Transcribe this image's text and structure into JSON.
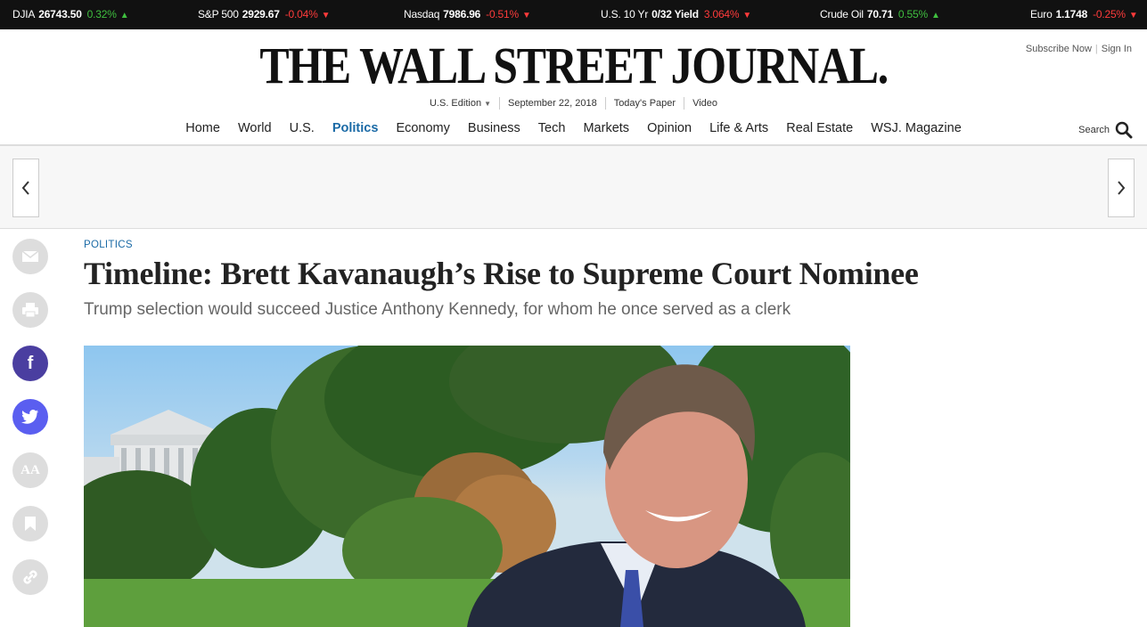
{
  "ticker": [
    {
      "name": "DJIA",
      "value": "26743.50",
      "change": "0.32%",
      "dir": "up"
    },
    {
      "name": "S&P 500",
      "value": "2929.67",
      "change": "-0.04%",
      "dir": "down"
    },
    {
      "name": "Nasdaq",
      "value": "7986.96",
      "change": "-0.51%",
      "dir": "down"
    },
    {
      "name": "U.S. 10 Yr",
      "value": "0/32 Yield",
      "change": "3.064%",
      "dir": "down"
    },
    {
      "name": "Crude Oil",
      "value": "70.71",
      "change": "0.55%",
      "dir": "up"
    },
    {
      "name": "Euro",
      "value": "1.1748",
      "change": "-0.25%",
      "dir": "down"
    }
  ],
  "header": {
    "logo": "THE WALL STREET JOURNAL.",
    "subscribe": "Subscribe Now",
    "signin": "Sign In",
    "edition": "U.S. Edition",
    "date": "September 22, 2018",
    "todays_paper": "Today's Paper",
    "video": "Video"
  },
  "nav": {
    "items": [
      "Home",
      "World",
      "U.S.",
      "Politics",
      "Economy",
      "Business",
      "Tech",
      "Markets",
      "Opinion",
      "Life & Arts",
      "Real Estate",
      "WSJ. Magazine"
    ],
    "active": "Politics",
    "search_label": "Search"
  },
  "article": {
    "kicker": "POLITICS",
    "headline": "Timeline: Brett Kavanaugh’s Rise to Supreme Court Nominee",
    "dek": "Trump selection would succeed Justice Anthony Kennedy, for whom he once served as a clerk"
  },
  "rail": [
    "email-icon",
    "print-icon",
    "facebook-icon",
    "twitter-icon",
    "text-size-icon",
    "bookmark-icon",
    "link-icon"
  ],
  "colors": {
    "accent": "#1a6aa6",
    "facebook": "#4a3ea0",
    "twitter": "#5a5ef0",
    "up": "#3fbf3f",
    "down": "#ff3b3b"
  }
}
